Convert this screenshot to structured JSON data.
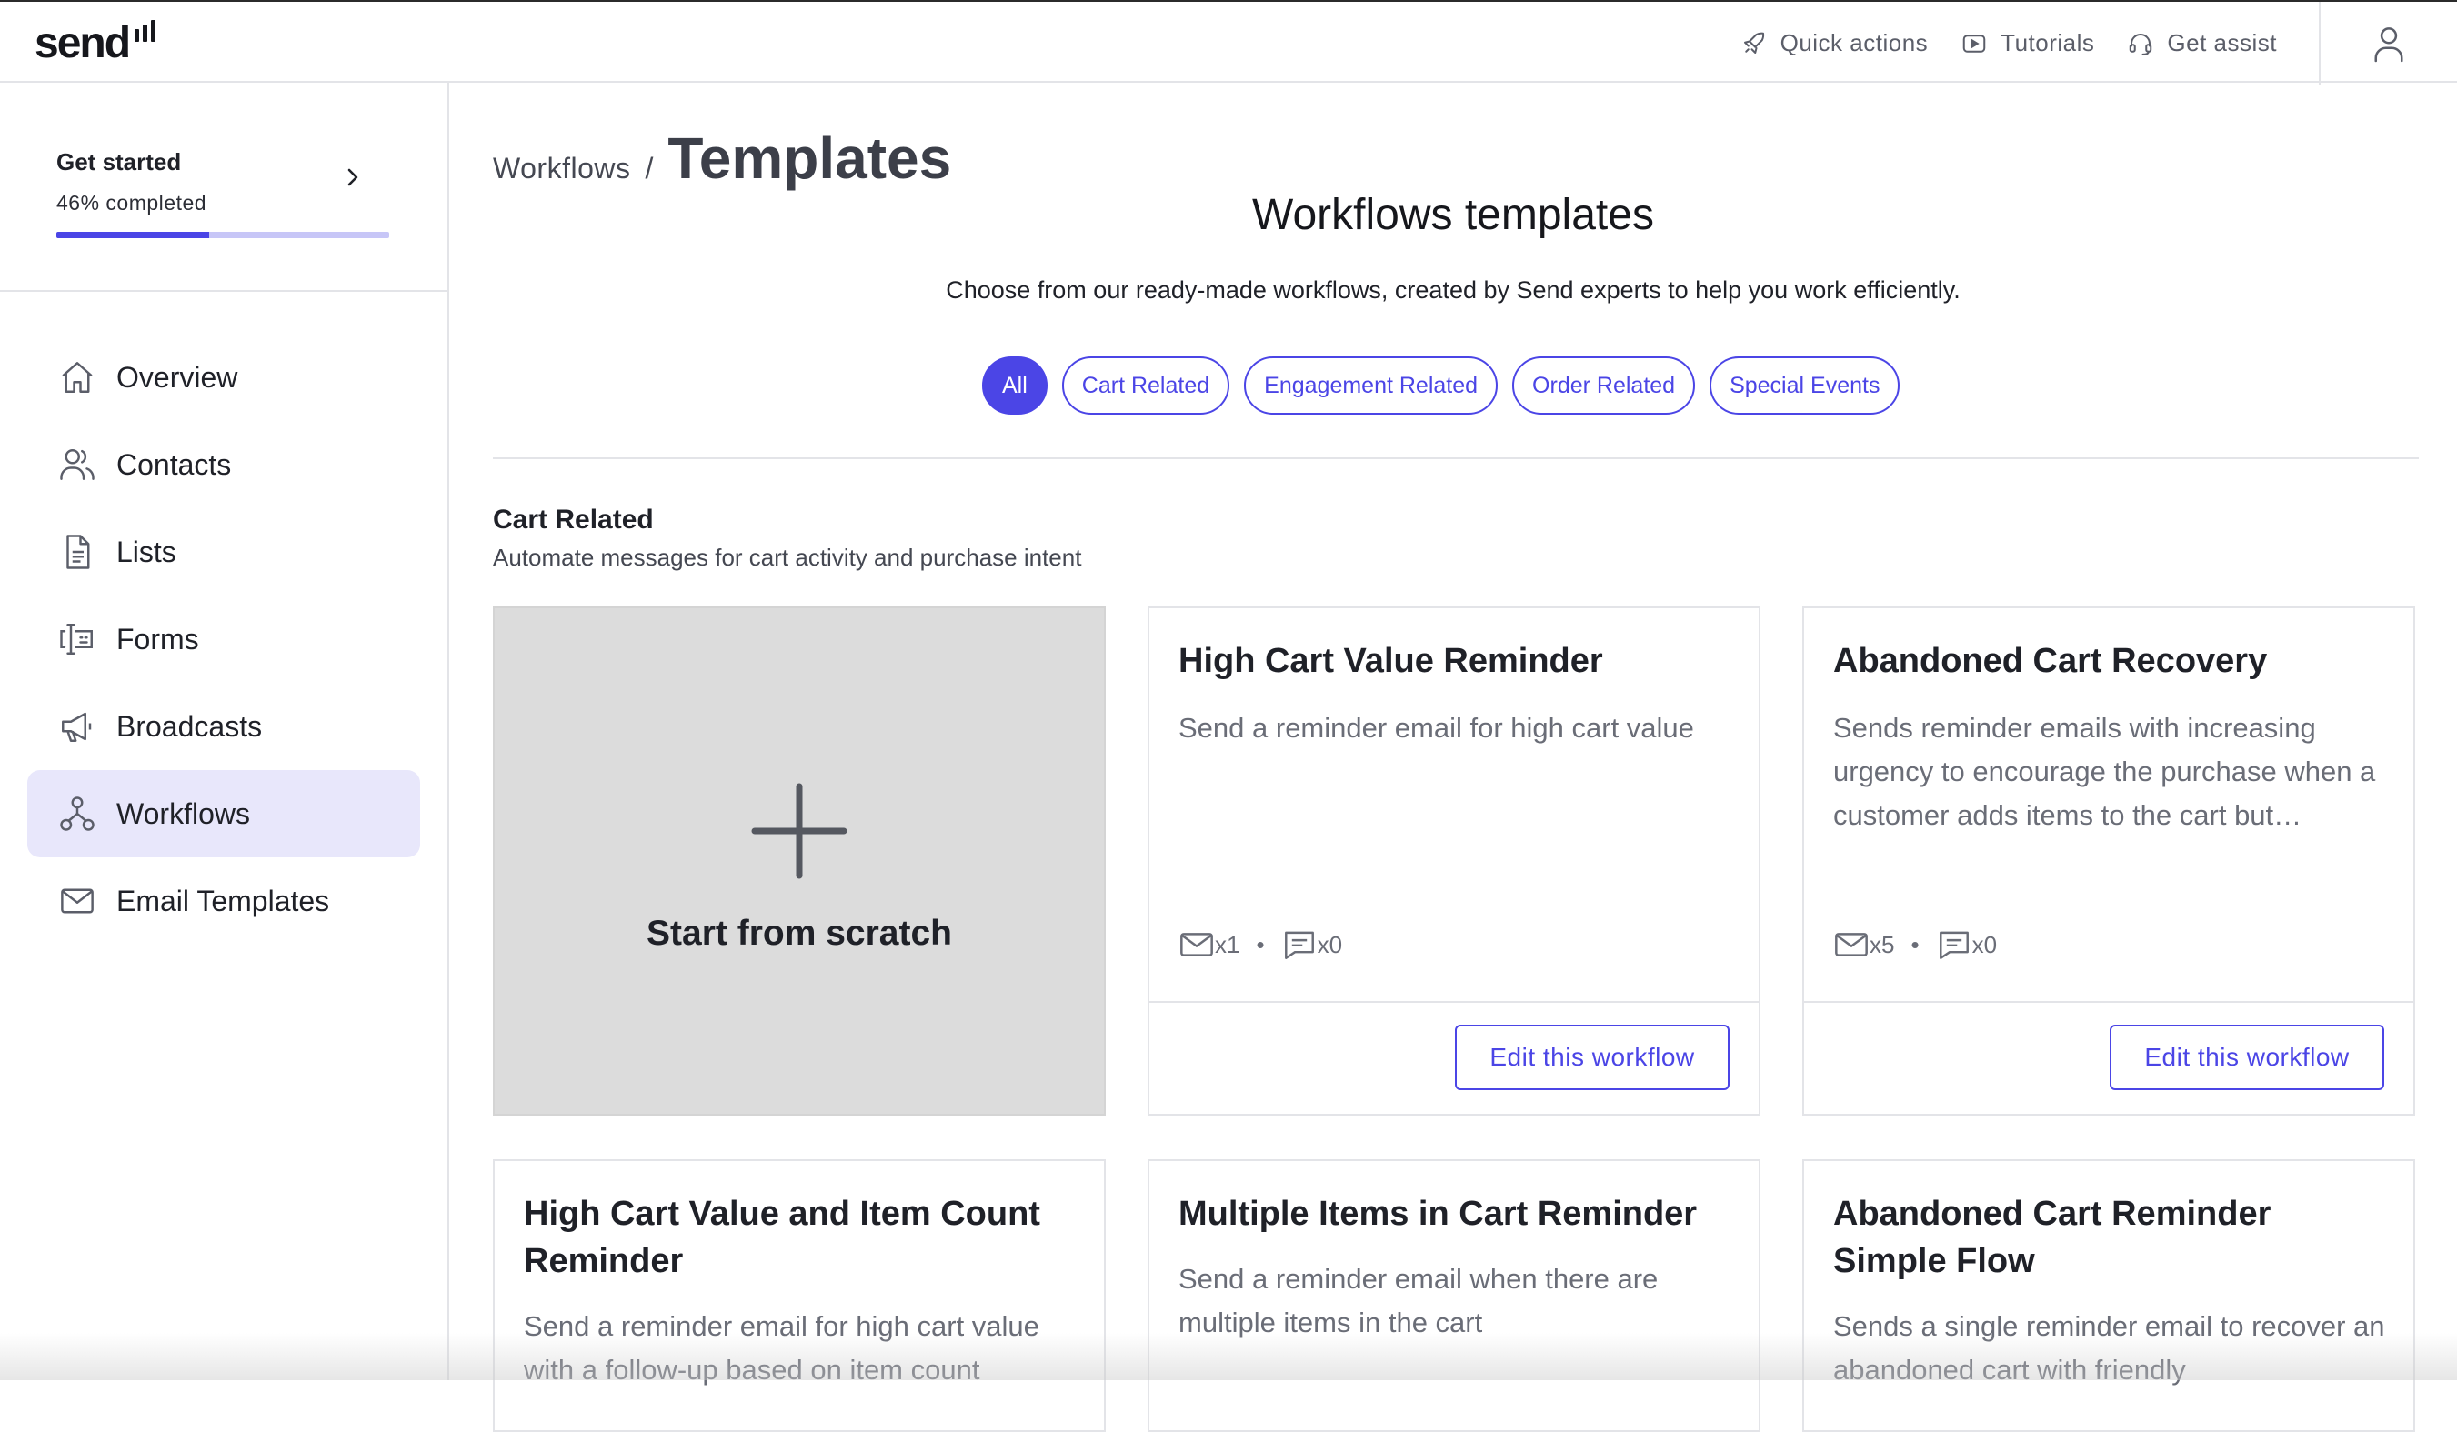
{
  "app": {
    "logo_text": "send"
  },
  "topbar": {
    "actions": [
      {
        "label": "Quick actions",
        "icon": "rocket-icon"
      },
      {
        "label": "Tutorials",
        "icon": "play-icon"
      },
      {
        "label": "Get assist",
        "icon": "headset-icon"
      }
    ],
    "profile_icon": "user-icon"
  },
  "sidebar": {
    "get_started": {
      "title": "Get started",
      "progress_text": "46% completed",
      "progress": 0.46
    },
    "items": [
      {
        "label": "Overview",
        "icon": "home-icon",
        "active": false
      },
      {
        "label": "Contacts",
        "icon": "contacts-icon",
        "active": false
      },
      {
        "label": "Lists",
        "icon": "document-icon",
        "active": false
      },
      {
        "label": "Forms",
        "icon": "form-icon",
        "active": false
      },
      {
        "label": "Broadcasts",
        "icon": "megaphone-icon",
        "active": false
      },
      {
        "label": "Workflows",
        "icon": "workflow-icon",
        "active": true
      },
      {
        "label": "Email Templates",
        "icon": "mail-icon",
        "active": false
      }
    ]
  },
  "main": {
    "breadcrumb": {
      "parent": "Workflows",
      "separator": "/",
      "current": "Templates"
    },
    "heading": "Workflows templates",
    "subheading": "Choose from our ready-made workflows, created by Send experts to help you work efficiently.",
    "filters": [
      {
        "label": "All",
        "active": true
      },
      {
        "label": "Cart Related",
        "active": false
      },
      {
        "label": "Engagement Related",
        "active": false
      },
      {
        "label": "Order Related",
        "active": false
      },
      {
        "label": "Special Events",
        "active": false
      }
    ],
    "section": {
      "title": "Cart Related",
      "subtitle": "Automate messages for cart activity and purchase intent"
    },
    "scratch_card": {
      "label": "Start from scratch"
    },
    "edit_label": "Edit this workflow",
    "cards": [
      {
        "title": "High Cart Value Reminder",
        "description": "Send a reminder email for high cart value",
        "emails": "x1",
        "sms": "x0"
      },
      {
        "title": "Abandoned Cart Recovery",
        "description": "Sends reminder emails with increasing urgency to encourage the purchase when a customer adds items to the cart but…",
        "emails": "x5",
        "sms": "x0"
      },
      {
        "title": "High Cart Value and Item Count Reminder",
        "description": "Send a reminder email for high cart value with a follow-up based on item count"
      },
      {
        "title": "Multiple Items in Cart Reminder",
        "description": "Send a reminder email when there are multiple items in the cart"
      },
      {
        "title": "Abandoned Cart Reminder Simple Flow",
        "description": "Sends a single reminder email to recover an abandoned cart with friendly"
      }
    ]
  },
  "colors": {
    "accent": "#4b45e6",
    "accent_light": "#e8e7fb",
    "progress_track": "#c7c6f7"
  }
}
